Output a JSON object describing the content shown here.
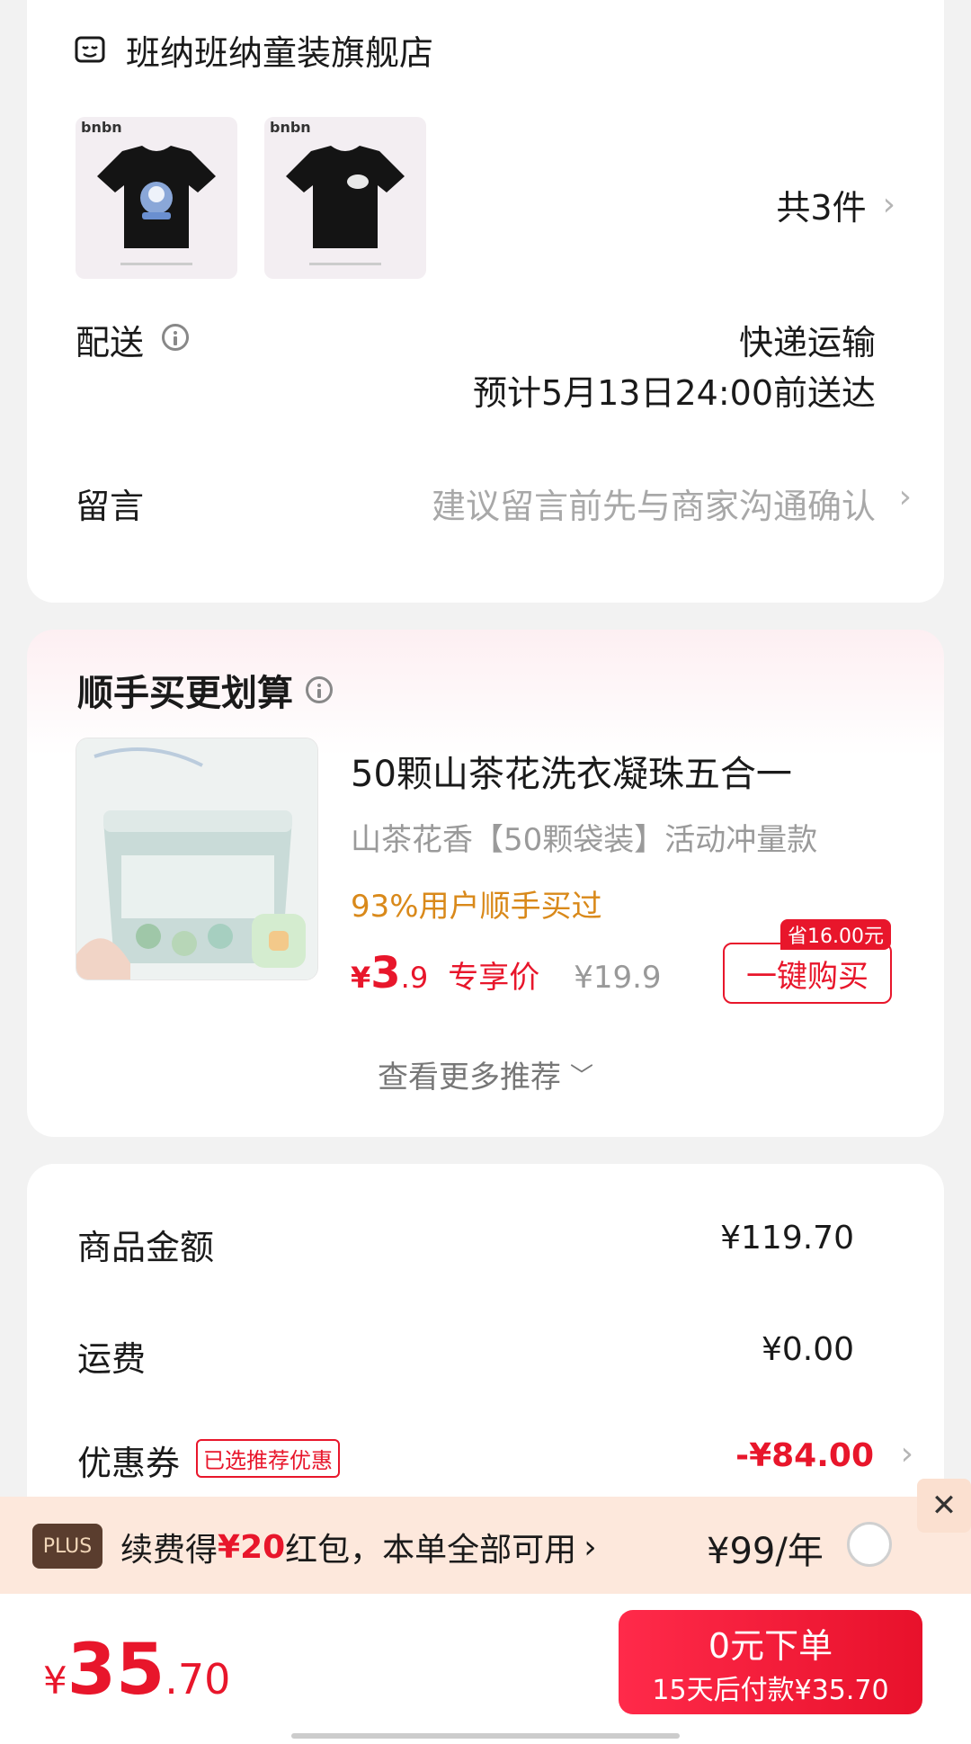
{
  "store": {
    "name": "班纳班纳童装旗舰店",
    "item_count": "共3件",
    "product_brand": "bnbn"
  },
  "delivery": {
    "label": "配送",
    "method": "快递运输",
    "eta": "预计5月13日24:00前送达"
  },
  "message": {
    "label": "留言",
    "placeholder": "建议留言前先与商家沟通确认"
  },
  "addon": {
    "title": "顺手买更划算",
    "product_title": "50颗山茶花洗衣凝珠五合一",
    "product_spec": "山茶花香【50颗袋装】活动冲量款",
    "buyers": "93%用户顺手买过",
    "price_symbol": "¥",
    "price_int": "3",
    "price_dec": ".9",
    "price_tag": "专享价",
    "original_price": "¥19.9",
    "save_badge": "省16.00元",
    "buy_button": "一键购买",
    "more": "查看更多推荐"
  },
  "summary": {
    "goods_label": "商品金额",
    "goods_value": "¥119.70",
    "shipping_label": "运费",
    "shipping_value": "¥0.00",
    "coupon_label": "优惠券",
    "coupon_tag": "已选推荐优惠",
    "coupon_value": "-¥84.00"
  },
  "plus": {
    "badge": "PLUS",
    "text_prefix": "续费得",
    "text_amount": "¥20",
    "text_suffix": "红包，本单全部可用",
    "price": "¥99/年"
  },
  "bottom": {
    "total_symbol": "¥",
    "total_int": "35",
    "total_dec": ".70",
    "cta_main": "0元下单",
    "cta_sub": "15天后付款¥35.70"
  },
  "colors": {
    "accent": "#e8162b",
    "orange": "#d9891a",
    "plus_bg": "#fde8dc",
    "plus_badge": "#5a3d2e"
  }
}
